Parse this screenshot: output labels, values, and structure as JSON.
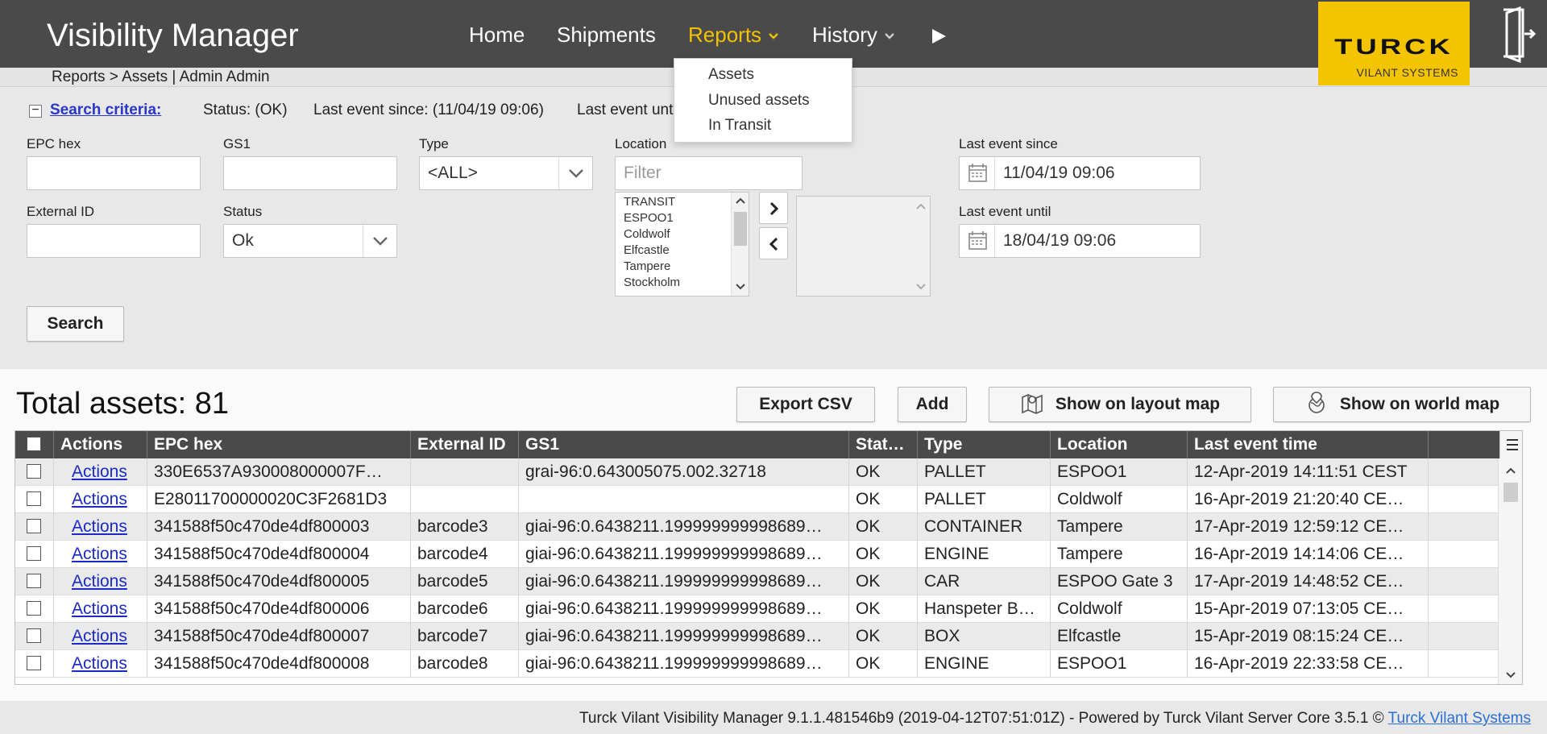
{
  "header": {
    "app_title": "Visibility Manager",
    "nav": [
      {
        "label": "Home"
      },
      {
        "label": "Shipments"
      },
      {
        "label": "Reports"
      },
      {
        "label": "History"
      }
    ],
    "more_icon": "play-arrow-icon",
    "brand_logo": "TURCK",
    "brand_sub": "VILANT SYSTEMS",
    "logout_icon": "logout-door-icon",
    "accent_color": "#f2c200"
  },
  "breadcrumb": "Reports > Assets | Admin Admin",
  "reports_menu": [
    "Assets",
    "Unused assets",
    "In Transit"
  ],
  "criteria": {
    "toggle": "−",
    "title": "Search criteria:",
    "status": "Status: (OK)",
    "since": "Last event since: (11/04/19 09:06)",
    "until": "Last event until"
  },
  "form": {
    "epc_label": "EPC hex",
    "epc_value": "",
    "gs1_label": "GS1",
    "gs1_value": "",
    "type_label": "Type",
    "type_value": "<ALL>",
    "external_id_label": "External ID",
    "external_id_value": "",
    "status_label": "Status",
    "status_value": "Ok",
    "location_label": "Location",
    "location_placeholder": "Filter",
    "locations": [
      "TRANSIT",
      "ESPOO1",
      "Coldwolf",
      "Elfcastle",
      "Tampere",
      "Stockholm"
    ],
    "since_label": "Last event since",
    "since_value": "11/04/19 09:06",
    "until_label": "Last event until",
    "until_value": "18/04/19 09:06",
    "search_button": "Search"
  },
  "results": {
    "total": "Total assets: 81",
    "export_button": "Export CSV",
    "add_button": "Add",
    "layout_map_button": "Show on layout map",
    "world_map_button": "Show on world map",
    "columns": [
      "Actions",
      "EPC hex",
      "External ID",
      "GS1",
      "Stat…",
      "Type",
      "Location",
      "Last event time"
    ],
    "rows": [
      {
        "action": "Actions",
        "epc": "330E6537A930008000007F…",
        "ext": "",
        "gs1": "grai-96:0.643005075.002.32718",
        "status": "OK",
        "type": "PALLET",
        "location": "ESPOO1",
        "time": "12-Apr-2019 14:11:51 CEST"
      },
      {
        "action": "Actions",
        "epc": "E28011700000020C3F2681D3",
        "ext": "",
        "gs1": "",
        "status": "OK",
        "type": "PALLET",
        "location": "Coldwolf",
        "time": "16-Apr-2019 21:20:40 CE…"
      },
      {
        "action": "Actions",
        "epc": "341588f50c470de4df800003",
        "ext": "barcode3",
        "gs1": "giai-96:0.6438211.199999999998689…",
        "status": "OK",
        "type": "CONTAINER",
        "location": "Tampere",
        "time": "17-Apr-2019 12:59:12 CE…"
      },
      {
        "action": "Actions",
        "epc": "341588f50c470de4df800004",
        "ext": "barcode4",
        "gs1": "giai-96:0.6438211.199999999998689…",
        "status": "OK",
        "type": "ENGINE",
        "location": "Tampere",
        "time": "16-Apr-2019 14:14:06 CE…"
      },
      {
        "action": "Actions",
        "epc": "341588f50c470de4df800005",
        "ext": "barcode5",
        "gs1": "giai-96:0.6438211.199999999998689…",
        "status": "OK",
        "type": "CAR",
        "location": "ESPOO Gate 3",
        "time": "17-Apr-2019 14:48:52 CE…"
      },
      {
        "action": "Actions",
        "epc": "341588f50c470de4df800006",
        "ext": "barcode6",
        "gs1": "giai-96:0.6438211.199999999998689…",
        "status": "OK",
        "type": "Hanspeter B…",
        "location": "Coldwolf",
        "time": "15-Apr-2019 07:13:05 CE…"
      },
      {
        "action": "Actions",
        "epc": "341588f50c470de4df800007",
        "ext": "barcode7",
        "gs1": "giai-96:0.6438211.199999999998689…",
        "status": "OK",
        "type": "BOX",
        "location": "Elfcastle",
        "time": "15-Apr-2019 08:15:24 CE…"
      },
      {
        "action": "Actions",
        "epc": "341588f50c470de4df800008",
        "ext": "barcode8",
        "gs1": "giai-96:0.6438211.199999999998689…",
        "status": "OK",
        "type": "ENGINE",
        "location": "ESPOO1",
        "time": "16-Apr-2019 22:33:58 CE…"
      }
    ]
  },
  "footer": {
    "text": "Turck Vilant Visibility Manager 9.1.1.481546b9 (2019-04-12T07:51:01Z) - Powered by Turck Vilant Server Core 3.5.1 ©",
    "link": "Turck Vilant Systems"
  }
}
